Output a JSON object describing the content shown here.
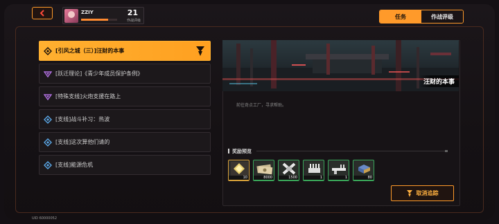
{
  "header": {
    "back_icon": "chevron-left-icon",
    "profile": {
      "name": "ZZIY",
      "level": "21",
      "level_caption": "作战评级",
      "progress": 0.75
    },
    "tabs": [
      {
        "label": "任务",
        "active": true
      },
      {
        "label": "作战评级",
        "active": false
      }
    ]
  },
  "quests": [
    {
      "label": "[引风之城（三）]汪财的本事",
      "icon": "main-quest-icon",
      "active": true,
      "color": "#1a1008"
    },
    {
      "label": "[跃迁理论]《青少年成员保护条例》",
      "icon": "purple-quest-icon",
      "active": false,
      "color": "#b070e0"
    },
    {
      "label": "[特殊支线]火炮支援在路上",
      "icon": "purple-quest-icon",
      "active": false,
      "color": "#b070e0"
    },
    {
      "label": "[支线]战斗补习：热波",
      "icon": "blue-quest-icon",
      "active": false,
      "color": "#5aa8e8"
    },
    {
      "label": "[支线]这次算他们请的",
      "icon": "blue-quest-icon",
      "active": false,
      "color": "#5aa8e8"
    },
    {
      "label": "[支线]能源危机",
      "icon": "blue-quest-icon",
      "active": false,
      "color": "#5aa8e8"
    }
  ],
  "detail": {
    "title": "汪财的本事",
    "description": "前往奇点工厂，寻求帮助。",
    "rewards_heading": "奖励预览",
    "rewards": [
      {
        "name": "gold-crystal-item",
        "count": "10",
        "rarity": "gold"
      },
      {
        "name": "money-item",
        "count": "8000",
        "rarity": "green"
      },
      {
        "name": "material-item",
        "count": "1500",
        "rarity": "green"
      },
      {
        "name": "ammo-item",
        "count": "1",
        "rarity": "green"
      },
      {
        "name": "weapon-item",
        "count": "1",
        "rarity": "green"
      },
      {
        "name": "book-item",
        "count": "80",
        "rarity": "green"
      }
    ],
    "cancel_track_label": "取消追踪"
  },
  "footer": {
    "uid": "UID 60000052"
  },
  "colors": {
    "accent": "#ff9a2a",
    "active_quest": "#ffb030",
    "background": "#141014"
  }
}
